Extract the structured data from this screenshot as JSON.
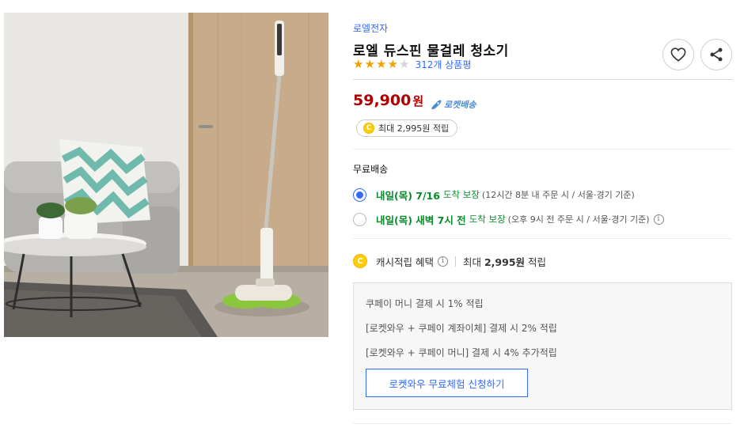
{
  "product": {
    "brand": "로엘전자",
    "title": "로엘 듀스핀 물걸레 청소기",
    "rating": 4,
    "rating_max": 5,
    "review_count": "312개 상품평",
    "image_icon": "product-photo-spin-mop"
  },
  "actions": {
    "wishlist_icon": "heart-icon",
    "share_icon": "share-icon"
  },
  "price": {
    "amount": "59,900",
    "unit": "원",
    "rocket_label": "로켓배송",
    "cash_chip": "최대 2,995원 적립",
    "coin_symbol": "C"
  },
  "shipping": {
    "label": "무료배송",
    "options": [
      {
        "date": "내일(목) 7/16",
        "guarantee": "도착 보장",
        "condition": "(12시간 8분 내 주문 시 / 서울·경기 기준)",
        "selected": true
      },
      {
        "date": "내일(목) 새벽 7시 전",
        "guarantee": "도착 보장",
        "condition": "(오후 9시 전 주문 시 / 서울·경기 기준)",
        "selected": false
      }
    ],
    "info_symbol": "i"
  },
  "cash": {
    "label": "캐시적립 혜택",
    "max_prefix": "최대",
    "max_amount": "2,995원",
    "max_suffix": "적립"
  },
  "benefits": {
    "lines": [
      "쿠페이 머니 결제 시 1% 적립",
      "[로켓와우 + 쿠페이 계좌이체] 결제 시 2% 적립",
      "[로켓와우 + 쿠페이 머니] 결제 시 4% 추가적립"
    ],
    "button": "로켓와우 무료체험 신청하기"
  },
  "colors": {
    "accent_blue": "#346aff",
    "price_red": "#ae0000",
    "delivery_green": "#0a8a2a",
    "star_orange": "#f2a100",
    "coin_yellow": "#ffcd00"
  }
}
